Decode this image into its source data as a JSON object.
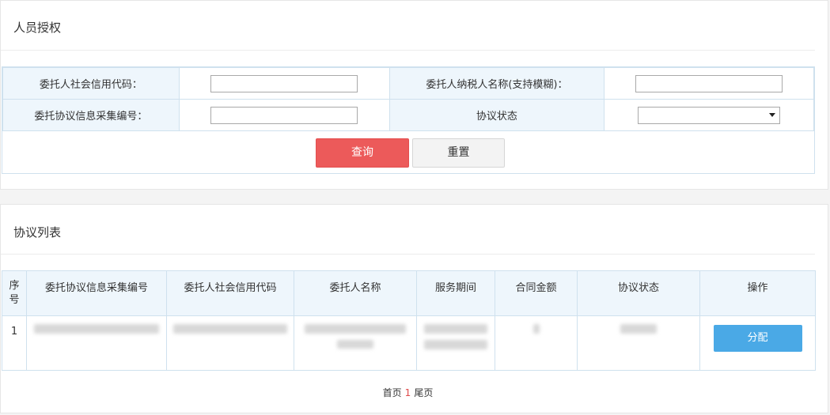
{
  "auth_panel": {
    "title": "人员授权",
    "form": {
      "credit_code_label": "委托人社会信用代码：",
      "credit_code_value": "",
      "taxpayer_name_label": "委托人纳税人名称(支持模糊)：",
      "taxpayer_name_value": "",
      "agreement_no_label": "委托协议信息采集编号：",
      "agreement_no_value": "",
      "status_label": "协议状态",
      "status_value": ""
    },
    "query_button": "查询",
    "reset_button": "重置"
  },
  "list_panel": {
    "title": "协议列表",
    "columns": [
      "序号",
      "委托协议信息采集编号",
      "委托人社会信用代码",
      "委托人名称",
      "服务期间",
      "合同金额",
      "协议状态",
      "操作"
    ],
    "rows": [
      {
        "seq": "1",
        "action": "分配"
      }
    ],
    "pager": {
      "first": "首页",
      "current": "1",
      "last": "尾页"
    }
  },
  "colors": {
    "query_button": "#ec5a5a",
    "assign_button": "#4aa9e6",
    "header_bg": "#eef6fc",
    "border": "#cfe1ee"
  }
}
